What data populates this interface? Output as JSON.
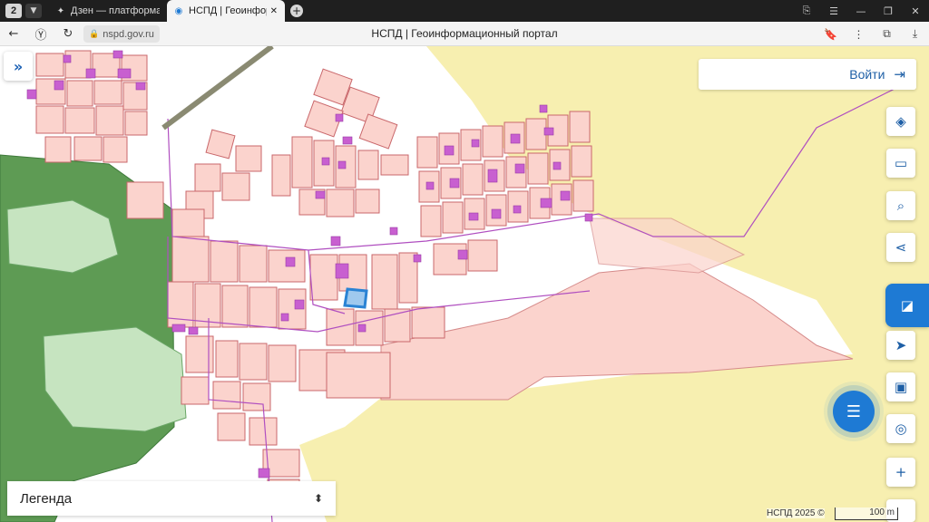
{
  "browser": {
    "tab_count": "2",
    "tabs": [
      {
        "label": "Дзен — платформа для п"
      },
      {
        "label": "НСПД | Геоинформаці"
      }
    ],
    "url": "nspd.gov.ru",
    "page_title": "НСПД | Геоинформационный портал"
  },
  "map": {
    "login_label": "Войти",
    "legend_label": "Легенда",
    "attribution": "НСПД 2025 ©",
    "scale_label": "100 m",
    "toolbar": [
      "layers-icon",
      "ruler-icon",
      "search-area-icon",
      "share-icon",
      "nspd-logo-icon",
      "navigate-icon",
      "minimap-icon",
      "locate-icon",
      "zoom-in-icon"
    ],
    "colors": {
      "background_land": "#f7efb0",
      "forest": "#5e9b54",
      "light_forest": "#c6e4c0",
      "parcel_fill": "#fbd3cd",
      "parcel_stroke": "#c9676b",
      "building": "#c85fd0",
      "selected_parcel": "#2a83d4",
      "accent": "#1e7ad4"
    }
  }
}
